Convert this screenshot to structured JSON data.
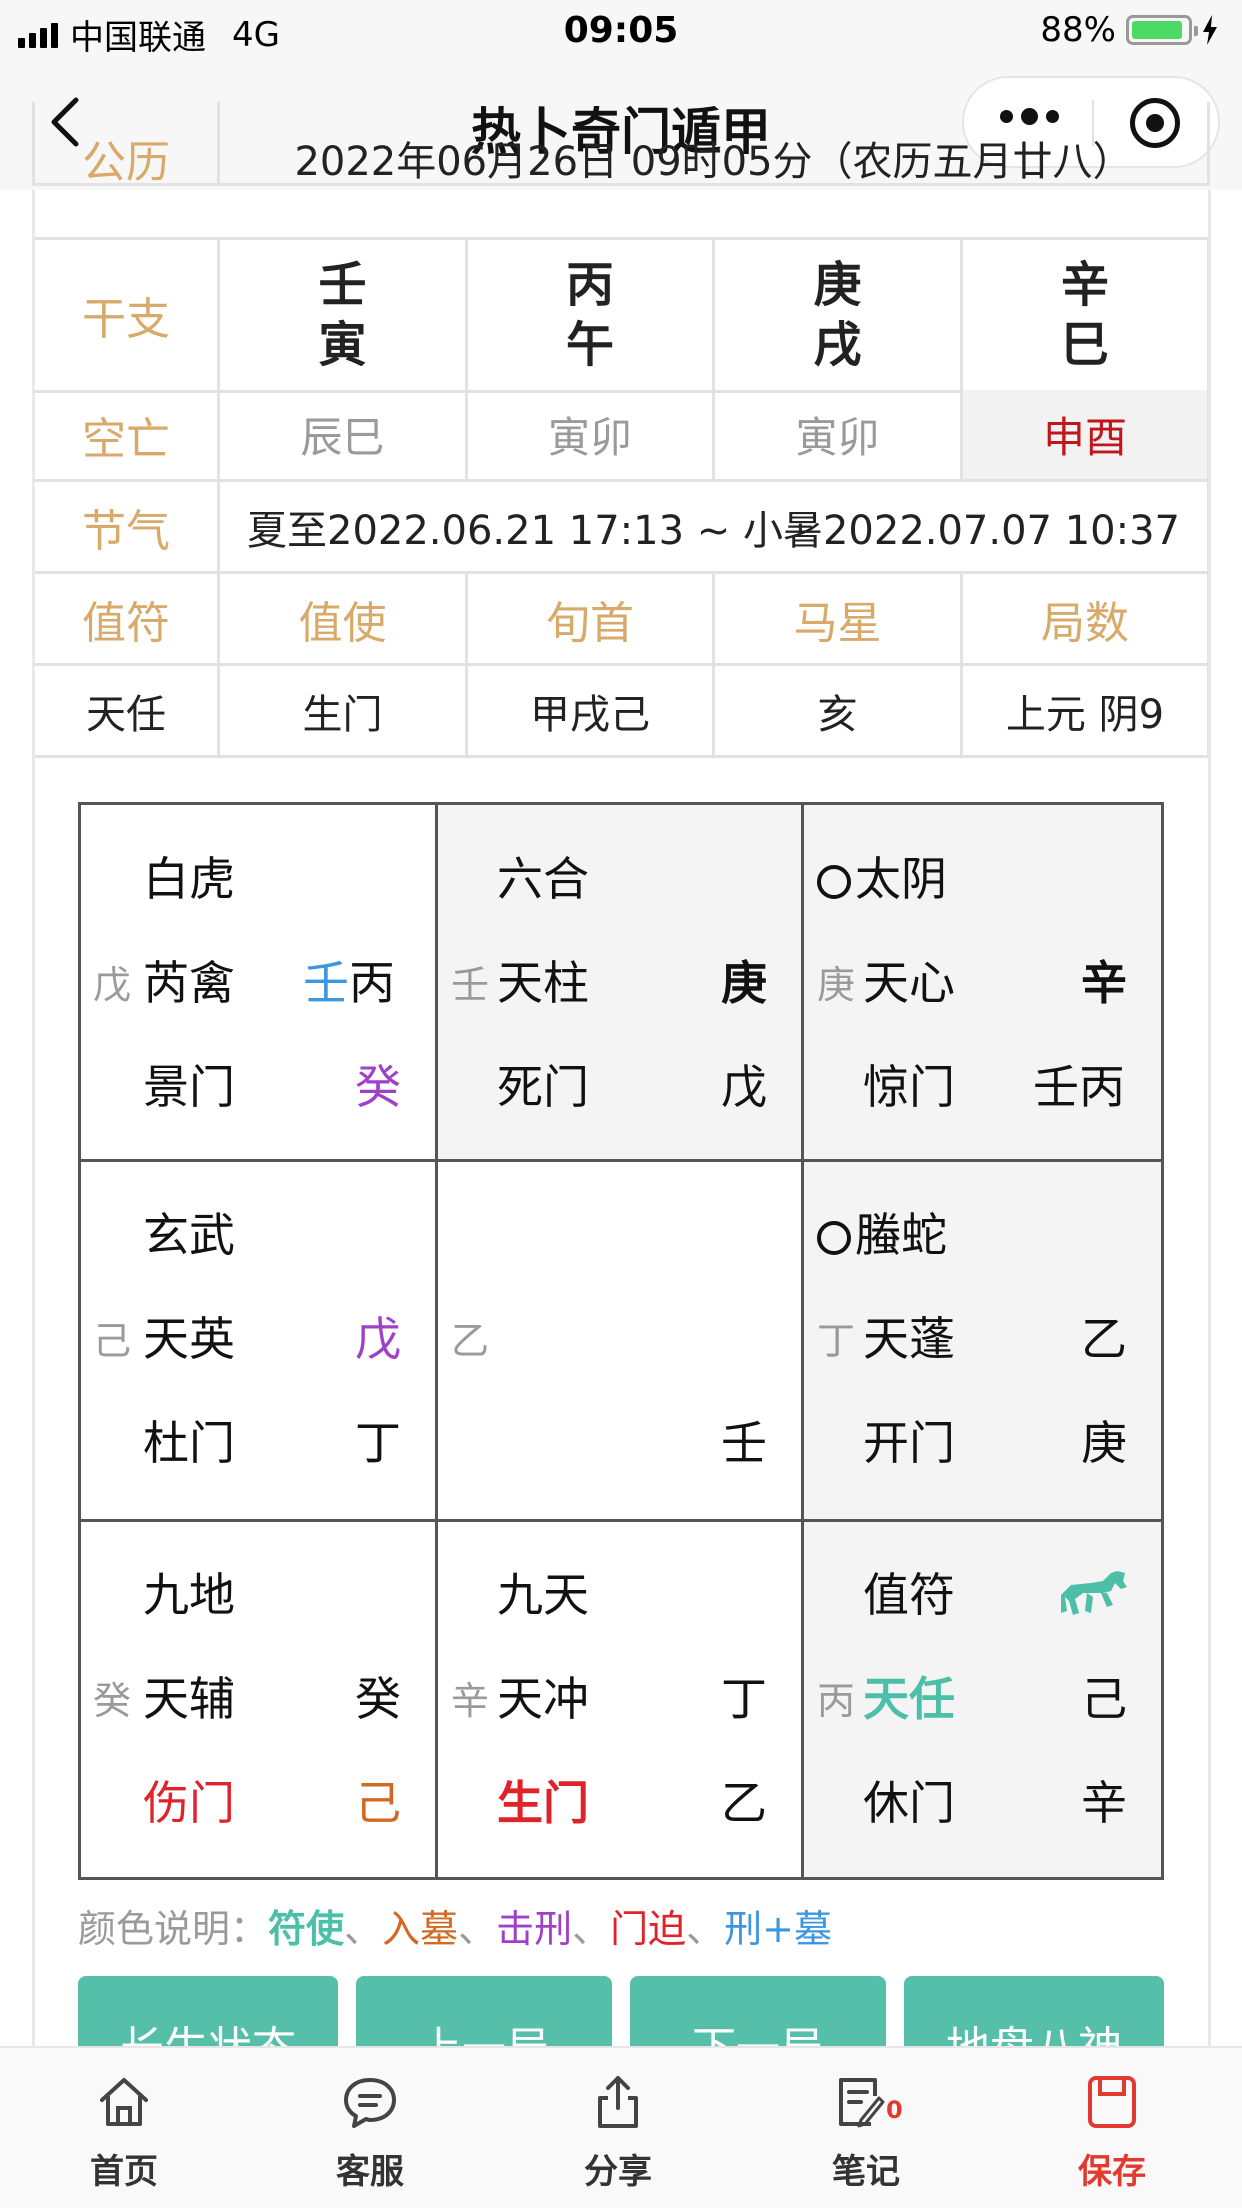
{
  "status_bar": {
    "carrier": "中国联通",
    "network": "4G",
    "time": "09:05",
    "battery": "88%",
    "battery_level": 0.88
  },
  "nav": {
    "title": "热卜奇门遁甲"
  },
  "info": {
    "gongli_label": "公历",
    "gongli_value": "2022年06月26日 09时05分（农历五月廿八）",
    "ganzhi_label": "干支",
    "ganzhi": [
      {
        "top": "壬",
        "bottom": "寅"
      },
      {
        "top": "丙",
        "bottom": "午"
      },
      {
        "top": "庚",
        "bottom": "戌"
      },
      {
        "top": "辛",
        "bottom": "巳"
      }
    ],
    "kongwang_label": "空亡",
    "kongwang": [
      "辰巳",
      "寅卯",
      "寅卯",
      "申酉"
    ],
    "jieqi_label": "节气",
    "jieqi_value": "夏至2022.06.21 17:13 ~ 小暑2022.07.07 10:37",
    "headers": [
      "值符",
      "值使",
      "旬首",
      "马星",
      "局数"
    ],
    "values": [
      "天任",
      "生门",
      "甲戌己",
      "亥",
      "上元 阴9"
    ]
  },
  "palaces": {
    "p1": {
      "god": "白虎",
      "dp": "戊",
      "star": "芮禽",
      "mark": "壬",
      "tp": "丙",
      "door": "景门",
      "br": "癸"
    },
    "p2": {
      "god": "六合",
      "dp": "壬",
      "star": "天柱",
      "tp": "庚",
      "door": "死门",
      "br": "戊"
    },
    "p3": {
      "god": "太阴",
      "dp": "庚",
      "star": "天心",
      "tp": "辛",
      "door": "惊门",
      "br": "壬丙"
    },
    "p4": {
      "god": "玄武",
      "dp": "己",
      "star": "天英",
      "tp": "戊",
      "door": "杜门",
      "br": "丁"
    },
    "p5": {
      "dp": "乙",
      "br": "壬"
    },
    "p6": {
      "god": "螣蛇",
      "dp": "丁",
      "star": "天蓬",
      "tp": "乙",
      "door": "开门",
      "br": "庚"
    },
    "p7": {
      "god": "九地",
      "dp": "癸",
      "star": "天辅",
      "tp": "癸",
      "door": "伤门",
      "br": "己"
    },
    "p8": {
      "god": "九天",
      "dp": "辛",
      "star": "天冲",
      "tp": "丁",
      "door": "生门",
      "br": "乙"
    },
    "p9": {
      "god": "值符",
      "dp": "丙",
      "star": "天任",
      "tp": "己",
      "door": "休门",
      "br": "辛"
    }
  },
  "legend": {
    "label": "颜色说明：",
    "items": [
      "符使",
      "入墓",
      "击刑",
      "门迫",
      "刑+墓"
    ],
    "sep": "、"
  },
  "buttons": [
    "长生状态",
    "上一局",
    "下一局",
    "地盘八神"
  ],
  "tabs": [
    "首页",
    "客服",
    "分享",
    "笔记",
    "保存"
  ],
  "note_badge": "0",
  "colors": {
    "teal": "#4bbfa8",
    "orange": "#d06a22",
    "purple": "#a040c8",
    "red": "#e0232a",
    "blue": "#3c96e0",
    "gold": "#d8aa6a",
    "save_red": "#e23a2e"
  }
}
